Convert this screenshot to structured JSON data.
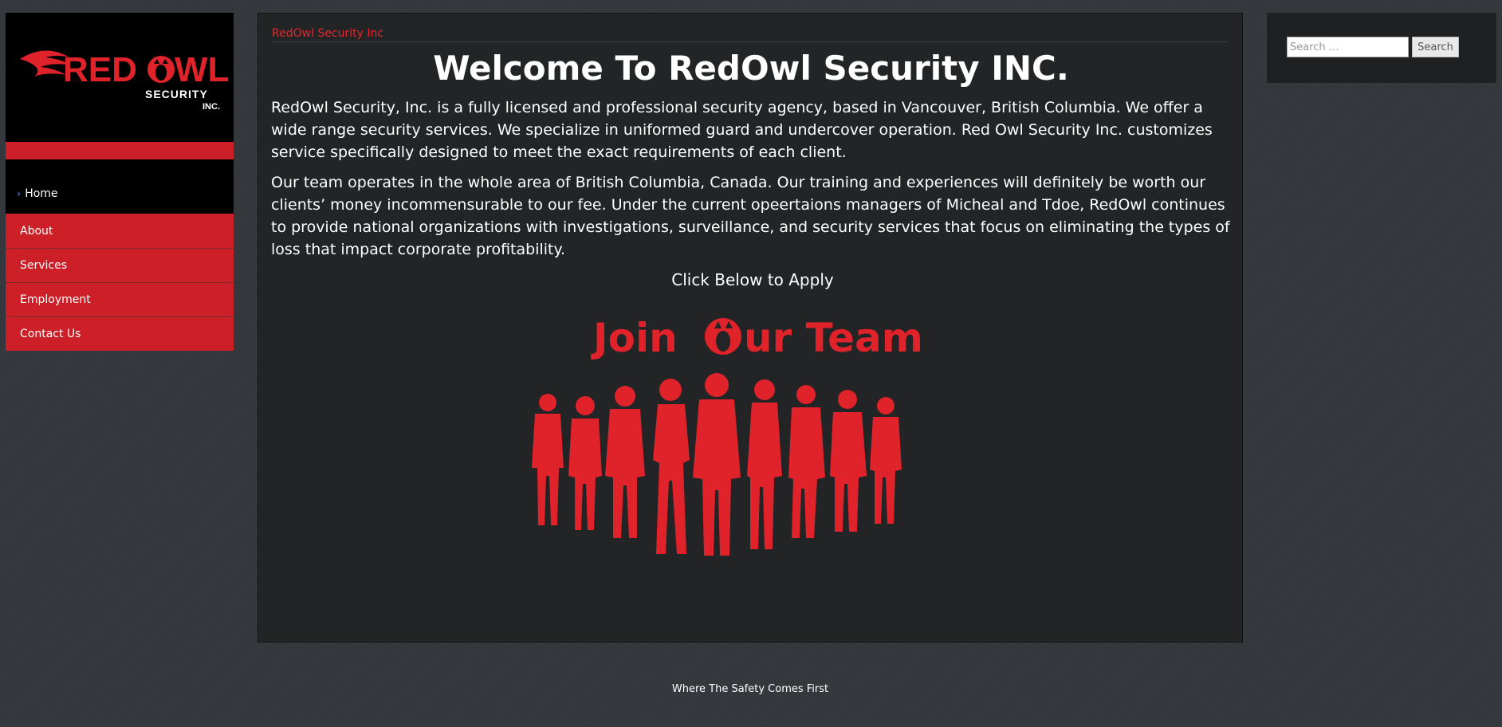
{
  "logo": {
    "brand_red": "RED",
    "brand_o": "O",
    "brand_wl": "WL",
    "line2": "SECURITY",
    "line3": "INC."
  },
  "nav": {
    "home": "Home",
    "items": [
      {
        "label": "About"
      },
      {
        "label": "Services"
      },
      {
        "label": "Employment"
      },
      {
        "label": "Contact Us"
      }
    ]
  },
  "main": {
    "site_name": "RedOwl Security Inc",
    "title": "Welcome To RedOwl Security INC.",
    "paragraph1": "RedOwl Security, Inc. is a fully licensed and professional security agency, based in Vancouver, British Columbia. We offer a wide range security services. We specialize in uniformed guard and undercover operation. Red Owl Security Inc. customizes service specifically designed to meet the exact requirements of each client.",
    "paragraph2": "Our team operates in the whole area of British Columbia, Canada. Our training and experiences will definitely be worth our clients’ money incommensurable to our fee. Under the current opeertaions managers of Micheal and Tdoe, RedOwl continues to provide national organizations with investigations, surveillance, and security services that focus on eliminating the types of loss that impact corporate profitability.",
    "apply_text": "Click Below to Apply",
    "banner_join": "Join ",
    "banner_o": "O",
    "banner_ur_team": "ur Team"
  },
  "search": {
    "placeholder": "Search …",
    "button": "Search"
  },
  "footer": {
    "tagline": "Where The Safety Comes First"
  },
  "colors": {
    "accent_red": "#cc1f27",
    "banner_red": "#e0222a",
    "background": "#34383c",
    "panel": "#222426"
  }
}
